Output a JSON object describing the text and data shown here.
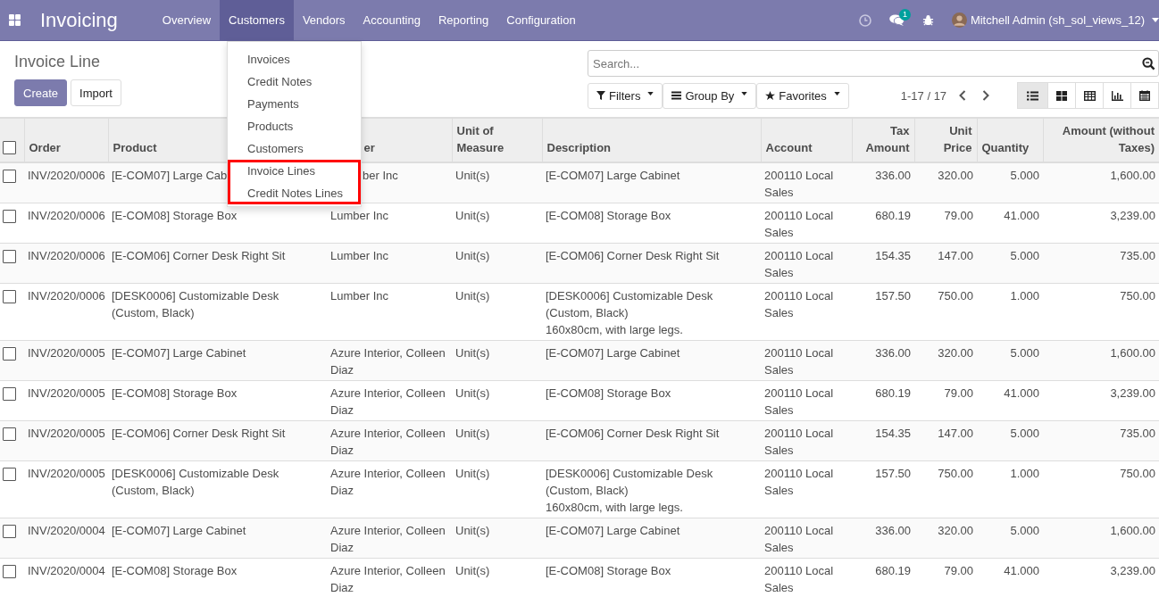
{
  "navbar": {
    "app_title": "Invoicing",
    "menu": [
      {
        "label": "Overview",
        "selected": false
      },
      {
        "label": "Customers",
        "selected": true
      },
      {
        "label": "Vendors",
        "selected": false
      },
      {
        "label": "Accounting",
        "selected": false
      },
      {
        "label": "Reporting",
        "selected": false
      },
      {
        "label": "Configuration",
        "selected": false
      }
    ],
    "messages_badge": "1",
    "user": "Mitchell Admin (sh_sol_views_12)"
  },
  "dropdown": {
    "items": [
      {
        "label": "Invoices",
        "highlighted": false
      },
      {
        "label": "Credit Notes",
        "highlighted": false
      },
      {
        "label": "Payments",
        "highlighted": false
      },
      {
        "label": "Products",
        "highlighted": false
      },
      {
        "label": "Customers",
        "highlighted": false
      },
      {
        "label": "Invoice Lines",
        "highlighted": true
      },
      {
        "label": "Credit Notes Lines",
        "highlighted": true
      }
    ]
  },
  "control_panel": {
    "title": "Invoice Line",
    "buttons": [
      {
        "label": "Create",
        "kind": "primary"
      },
      {
        "label": "Import",
        "kind": "secondary"
      }
    ],
    "search": {
      "placeholder": "Search..."
    },
    "filters": [
      {
        "label": "Filters",
        "kind": "filter"
      },
      {
        "label": "Group By",
        "kind": "group"
      },
      {
        "label": "Favorites",
        "kind": "star"
      }
    ],
    "pager": "1-17 / 17",
    "views": [
      {
        "kind": "list",
        "selected": true
      },
      {
        "kind": "kanban",
        "selected": false
      },
      {
        "kind": "pivot",
        "selected": false
      },
      {
        "kind": "graph",
        "selected": false
      },
      {
        "kind": "calendar",
        "selected": false
      }
    ]
  },
  "table": {
    "select_all_checked": false,
    "columns": [
      "Order",
      "Product",
      "er",
      "Unit of Measure",
      "Description",
      "Account",
      "Tax Amount",
      "Unit Price",
      "Quantity",
      "Amount (without Taxes)"
    ],
    "rows": [
      {
        "checked": false,
        "partner_covered_by_menu": true,
        "cells": [
          "INV/2020/0006",
          "[E-COM07] Large Cab",
          "ber Inc",
          "Unit(s)",
          "[E-COM07] Large Cabinet",
          "200110 Local Sales",
          "336.00",
          "320.00",
          "5.000",
          "1,600.00"
        ]
      },
      {
        "checked": false,
        "partner_covered_by_menu": false,
        "cells": [
          "INV/2020/0006",
          "[E-COM08] Storage Box",
          "Lumber Inc",
          "Unit(s)",
          "[E-COM08] Storage Box",
          "200110 Local Sales",
          "680.19",
          "79.00",
          "41.000",
          "3,239.00"
        ]
      },
      {
        "checked": false,
        "partner_covered_by_menu": false,
        "cells": [
          "INV/2020/0006",
          "[E-COM06] Corner Desk Right Sit",
          "Lumber Inc",
          "Unit(s)",
          "[E-COM06] Corner Desk Right Sit",
          "200110 Local Sales",
          "154.35",
          "147.00",
          "5.000",
          "735.00"
        ]
      },
      {
        "checked": false,
        "partner_covered_by_menu": false,
        "cells": [
          "INV/2020/0006",
          "[DESK0006] Customizable Desk (Custom, Black)",
          "Lumber Inc",
          "Unit(s)",
          "[DESK0006] Customizable Desk (Custom, Black)\n160x80cm, with large legs.",
          "200110 Local Sales",
          "157.50",
          "750.00",
          "1.000",
          "750.00"
        ]
      },
      {
        "checked": false,
        "partner_covered_by_menu": false,
        "cells": [
          "INV/2020/0005",
          "[E-COM07] Large Cabinet",
          "Azure Interior, Colleen Diaz",
          "Unit(s)",
          "[E-COM07] Large Cabinet",
          "200110 Local Sales",
          "336.00",
          "320.00",
          "5.000",
          "1,600.00"
        ]
      },
      {
        "checked": false,
        "partner_covered_by_menu": false,
        "cells": [
          "INV/2020/0005",
          "[E-COM08] Storage Box",
          "Azure Interior, Colleen Diaz",
          "Unit(s)",
          "[E-COM08] Storage Box",
          "200110 Local Sales",
          "680.19",
          "79.00",
          "41.000",
          "3,239.00"
        ]
      },
      {
        "checked": false,
        "partner_covered_by_menu": false,
        "cells": [
          "INV/2020/0005",
          "[E-COM06] Corner Desk Right Sit",
          "Azure Interior, Colleen Diaz",
          "Unit(s)",
          "[E-COM06] Corner Desk Right Sit",
          "200110 Local Sales",
          "154.35",
          "147.00",
          "5.000",
          "735.00"
        ]
      },
      {
        "checked": false,
        "partner_covered_by_menu": false,
        "cells": [
          "INV/2020/0005",
          "[DESK0006] Customizable Desk (Custom, Black)",
          "Azure Interior, Colleen Diaz",
          "Unit(s)",
          "[DESK0006] Customizable Desk (Custom, Black)\n160x80cm, with large legs.",
          "200110 Local Sales",
          "157.50",
          "750.00",
          "1.000",
          "750.00"
        ]
      },
      {
        "checked": false,
        "partner_covered_by_menu": false,
        "cells": [
          "INV/2020/0004",
          "[E-COM07] Large Cabinet",
          "Azure Interior, Colleen Diaz",
          "Unit(s)",
          "[E-COM07] Large Cabinet",
          "200110 Local Sales",
          "336.00",
          "320.00",
          "5.000",
          "1,600.00"
        ]
      },
      {
        "checked": false,
        "partner_covered_by_menu": false,
        "cells": [
          "INV/2020/0004",
          "[E-COM08] Storage Box",
          "Azure Interior, Colleen Diaz",
          "Unit(s)",
          "[E-COM08] Storage Box",
          "200110 Local Sales",
          "680.19",
          "79.00",
          "41.000",
          "3,239.00"
        ]
      }
    ]
  }
}
